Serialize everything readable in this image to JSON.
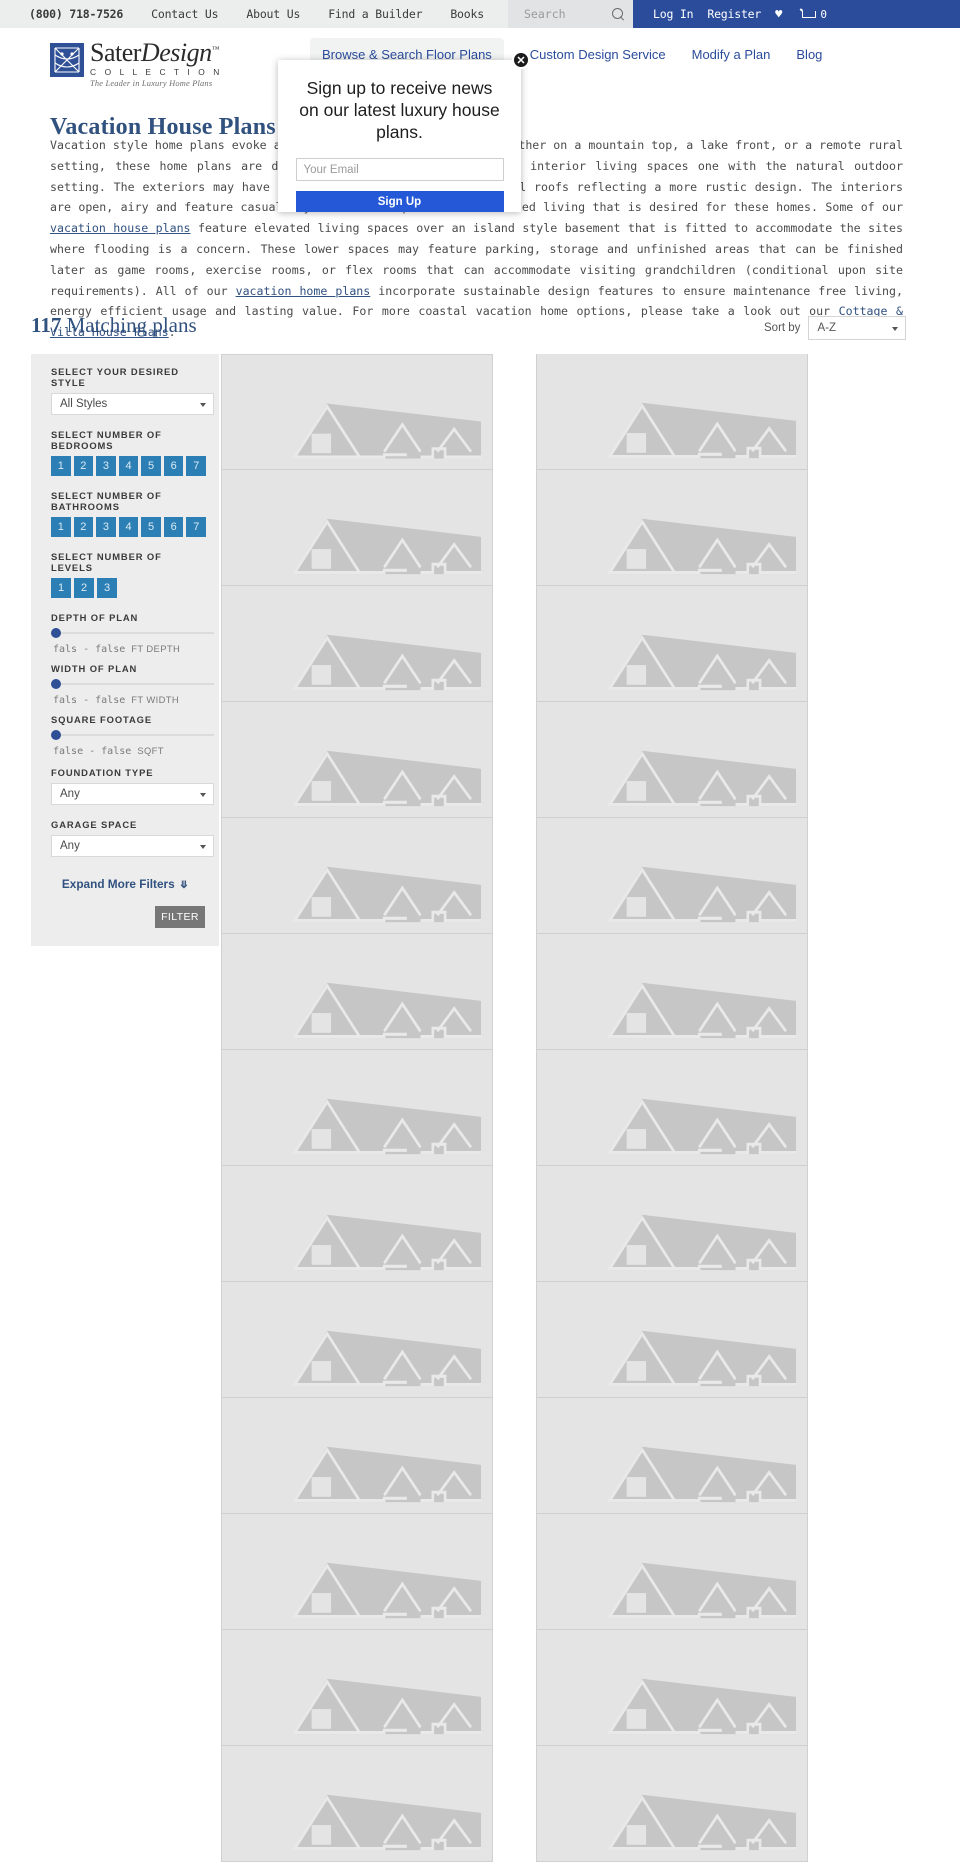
{
  "utility_bar": {
    "phone": "(800) 718-7526",
    "links": [
      "Contact Us",
      "About Us",
      "Find a Builder",
      "Books"
    ],
    "search_placeholder": "Search",
    "search_value": "",
    "search_icon": "search-icon",
    "login_label": "Log In",
    "register_label": "Register",
    "wishlist_icon": "heart-icon",
    "cart_icon": "cart-icon",
    "cart_count": "0",
    "accent_blue": "#2a4c9b"
  },
  "brand": {
    "name_part1": "Sater",
    "name_part2": "Design",
    "trademark": "™",
    "collection": "C O L L E C T I O N",
    "tagline": "The Leader in Luxury Home Plans",
    "logo_icon": "sater-logo-icon",
    "logo_color": "#2f4f96"
  },
  "nav": {
    "items": [
      {
        "label": "Browse & Search Floor Plans",
        "active": true
      },
      {
        "label": "Custom Design Service",
        "active": false
      },
      {
        "label": "Modify a Plan",
        "active": false
      },
      {
        "label": "Blog",
        "active": false
      }
    ]
  },
  "page": {
    "title": "Vacation House Plans",
    "intro_part1": "Vacation style home plans evoke a casual and relaxed lifestyle. Whether on a mountain top, a lake front, or a remote rural setting, these home plans are designed to capture views and make interior living spaces one with the natural outdoor setting. The exteriors may have lap siding with standing seam metal roofs reflecting a more rustic design. The interiors are open, airy and feature casual layouts that complement the relaxed living that is desired for these homes. Some of our ",
    "intro_link1": "vacation house plans",
    "intro_part2": " feature elevated living spaces over an island style basement that is fitted to accommodate the sites where flooding is a concern. These lower spaces may feature parking, storage and unfinished areas that can be finished later as game rooms, exercise rooms, or flex rooms that can accommodate visiting grandchildren (conditional upon site requirements). All of our ",
    "intro_link2": "vacation home plans",
    "intro_part3": " incorporate sustainable design features to ensure maintenance free living, energy efficient usage and lasting value. For more coastal vacation home options, please take a look out our ",
    "intro_link3": "Cottage & Villa House Plans",
    "intro_part4": "."
  },
  "results": {
    "count": "117",
    "count_label": "Matching plans",
    "sort_label": "Sort by",
    "sort_value": "A-Z",
    "sort_options": [
      "A-Z"
    ]
  },
  "filters": {
    "style": {
      "label": "SELECT YOUR DESIRED STYLE",
      "value": "All Styles"
    },
    "bedrooms": {
      "label": "SELECT NUMBER OF BEDROOMS",
      "options": [
        "1",
        "2",
        "3",
        "4",
        "5",
        "6",
        "7"
      ]
    },
    "bathrooms": {
      "label": "SELECT NUMBER OF BATHROOMS",
      "options": [
        "1",
        "2",
        "3",
        "4",
        "5",
        "6",
        "7"
      ]
    },
    "levels": {
      "label": "SELECT NUMBER OF LEVELS",
      "options": [
        "1",
        "2",
        "3"
      ]
    },
    "depth": {
      "label": "DEPTH OF PLAN",
      "range_text": "fals  -  false",
      "unit": "FT DEPTH"
    },
    "width": {
      "label": "WIDTH OF PLAN",
      "range_text": "fals  -  false",
      "unit": "FT WIDTH"
    },
    "sqft": {
      "label": "SQUARE FOOTAGE",
      "range_text": "false  -  false",
      "unit": "SQFT"
    },
    "foundation": {
      "label": "FOUNDATION TYPE",
      "value": "Any"
    },
    "garage": {
      "label": "GARAGE SPACE",
      "value": "Any"
    },
    "expand_label": "Expand More Filters",
    "expand_icon": "chevron-down-icon",
    "filter_button": "FILTER",
    "active_button_color": "#2b7fb5"
  },
  "modal": {
    "heading": "Sign up to receive news on our latest luxury house plans.",
    "email_placeholder": "Your Email",
    "email_value": "",
    "submit_label": "Sign Up",
    "close_icon": "close-icon",
    "button_color": "#2558d6"
  },
  "plan_grid": {
    "placeholder_icon": "broken-image-house-icon",
    "columns": 2,
    "cards": [
      {
        "col": "left"
      },
      {
        "col": "left"
      },
      {
        "col": "left"
      },
      {
        "col": "left"
      },
      {
        "col": "left"
      },
      {
        "col": "left"
      },
      {
        "col": "left"
      },
      {
        "col": "left"
      },
      {
        "col": "left"
      },
      {
        "col": "left"
      },
      {
        "col": "left"
      },
      {
        "col": "left"
      },
      {
        "col": "left"
      },
      {
        "col": "right"
      },
      {
        "col": "right"
      },
      {
        "col": "right"
      },
      {
        "col": "right"
      },
      {
        "col": "right"
      },
      {
        "col": "right"
      },
      {
        "col": "right"
      },
      {
        "col": "right"
      },
      {
        "col": "right"
      },
      {
        "col": "right"
      },
      {
        "col": "right"
      },
      {
        "col": "right"
      },
      {
        "col": "right"
      }
    ]
  }
}
